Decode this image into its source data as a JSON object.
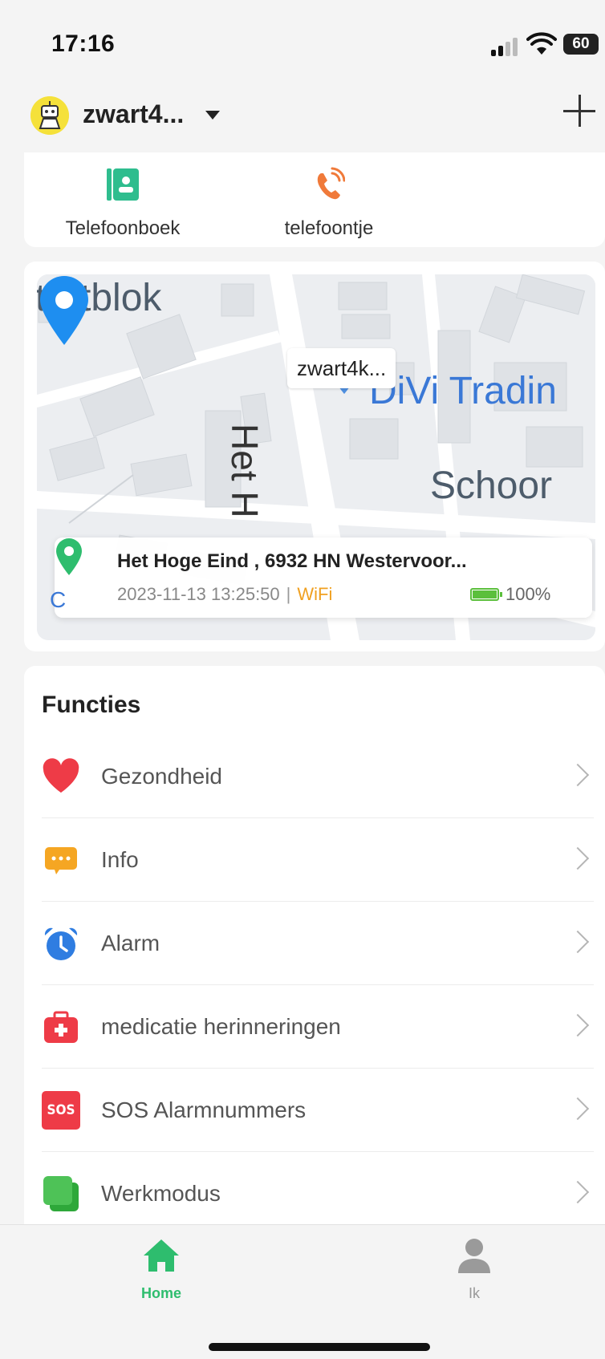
{
  "status_bar": {
    "time": "17:16",
    "battery": "60"
  },
  "header": {
    "device_name": "zwart4...",
    "add_icon": "plus-icon"
  },
  "shortcuts": [
    {
      "label": "Telefoonboek",
      "icon": "contacts-book-icon",
      "color": "#2ebd8e"
    },
    {
      "label": "telefoontje",
      "icon": "phone-call-icon",
      "color": "#f07a3a"
    }
  ],
  "map": {
    "labels": {
      "area": "tartblok",
      "poi": "DiVi Tradin",
      "street": "Het H",
      "place": "Schoor"
    },
    "marker_label": "zwart4k...",
    "location": {
      "address": "Het Hoge Eind      , 6932 HN Westervoor...",
      "timestamp": "2023-11-13 13:25:50",
      "separator": "|",
      "network": "WiFi",
      "battery": "100%"
    }
  },
  "functions": {
    "title": "Functies",
    "items": [
      {
        "label": "Gezondheid",
        "icon": "heart-icon",
        "color": "#ee3b47"
      },
      {
        "label": "Info",
        "icon": "message-icon",
        "color": "#f5a623"
      },
      {
        "label": "Alarm",
        "icon": "alarm-clock-icon",
        "color": "#2f7de1"
      },
      {
        "label": "medicatie herinneringen",
        "icon": "medical-kit-icon",
        "color": "#ee3b47"
      },
      {
        "label": "SOS Alarmnummers",
        "icon": "sos-icon",
        "color": "#ee3b47",
        "icon_text": "SOS"
      },
      {
        "label": "Werkmodus",
        "icon": "work-mode-icon",
        "color": "#3fb94a"
      }
    ]
  },
  "tabbar": {
    "tabs": [
      {
        "label": "Home",
        "icon": "home-icon",
        "active": true
      },
      {
        "label": "Ik",
        "icon": "person-icon",
        "active": false
      }
    ]
  }
}
